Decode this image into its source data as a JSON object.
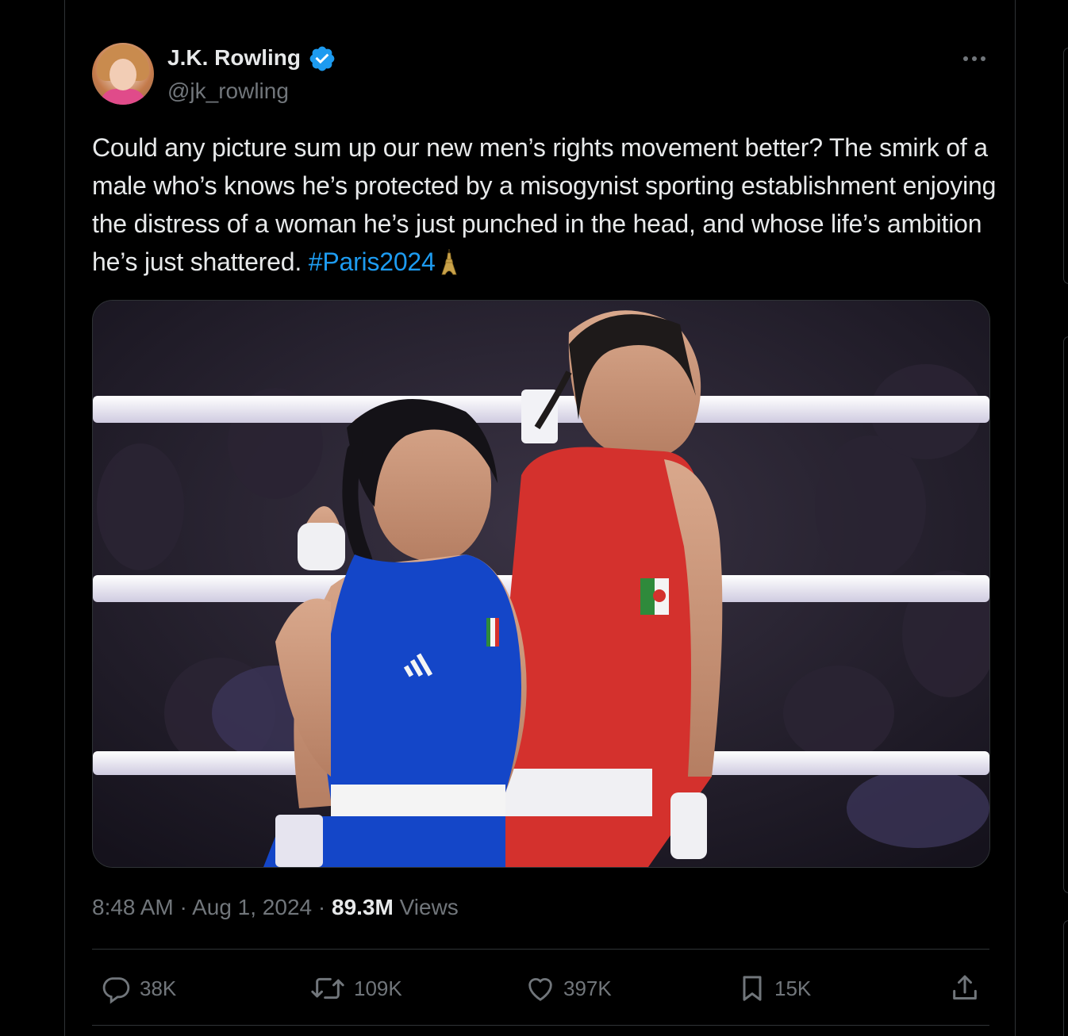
{
  "author": {
    "name": "J.K. Rowling",
    "handle": "@jk_rowling",
    "verified": true
  },
  "tweet": {
    "text": "Could any picture sum up our new men’s rights movement better? The smirk of a male who’s knows he’s protected by a misogynist sporting establishment enjoying the distress of a woman he’s just punched in the head, and whose life’s ambition he’s just shattered.",
    "hashtag": "#Paris2024",
    "emoji": "eiffel-tower"
  },
  "meta": {
    "time": "8:48 AM",
    "separator": "·",
    "date": "Aug 1, 2024",
    "views_count": "89.3M",
    "views_label": "Views"
  },
  "actions": {
    "replies": "38K",
    "reposts": "109K",
    "likes": "397K",
    "bookmarks": "15K"
  },
  "colors": {
    "background": "#000000",
    "text": "#e7e9ea",
    "muted": "#71767b",
    "link": "#1d9bf0",
    "border": "#2f3336",
    "verified": "#1d9bf0"
  },
  "icons": [
    "more-icon",
    "verified-badge-icon",
    "reply-icon",
    "repost-icon",
    "like-icon",
    "bookmark-icon",
    "share-icon"
  ]
}
